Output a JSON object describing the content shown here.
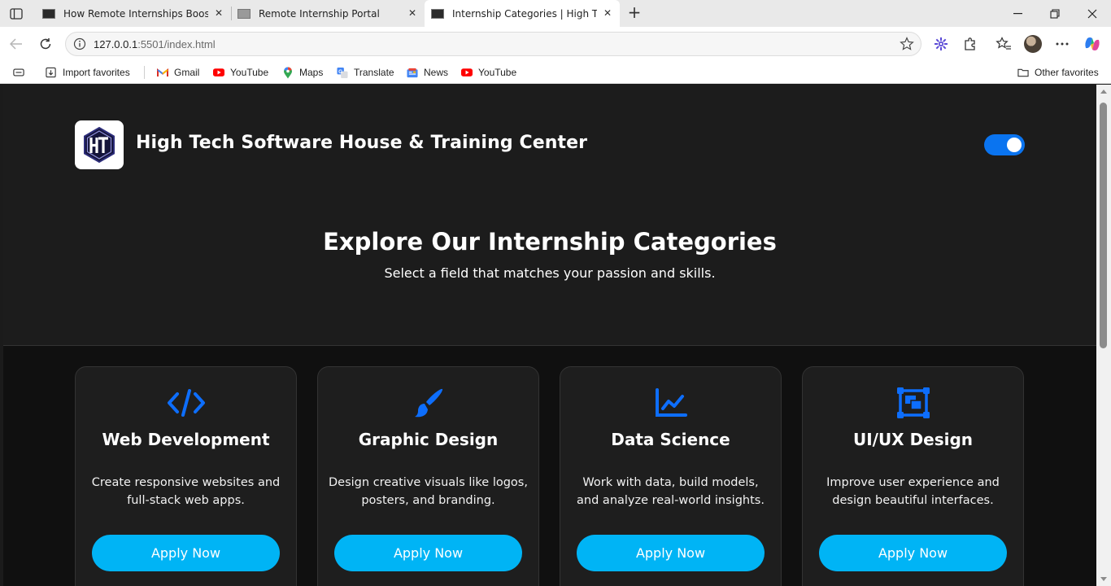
{
  "browser": {
    "tabs": [
      {
        "title": "How Remote Internships Boost Ca",
        "active": false
      },
      {
        "title": "Remote Internship Portal",
        "active": false
      },
      {
        "title": "Internship Categories | High Tech",
        "active": true
      }
    ],
    "url_host": "127.0.0.1",
    "url_rest": ":5501/index.html",
    "bookmarks": [
      {
        "label": "Import favorites",
        "icon": "import-icon"
      },
      {
        "label": "Gmail",
        "icon": "gmail-icon"
      },
      {
        "label": "YouTube",
        "icon": "youtube-icon"
      },
      {
        "label": "Maps",
        "icon": "maps-icon"
      },
      {
        "label": "Translate",
        "icon": "translate-icon"
      },
      {
        "label": "News",
        "icon": "news-icon"
      },
      {
        "label": "YouTube",
        "icon": "youtube-icon"
      }
    ],
    "other_favorites": "Other favorites"
  },
  "site": {
    "brand_name": "High Tech Software House & Training Center",
    "logo_text": "HT",
    "theme_toggle_on": true,
    "hero_title": "Explore Our Internship Categories",
    "hero_subtitle": "Select a field that matches your passion and skills.",
    "accent_color": "#0a74f0",
    "button_color": "#00b4f5",
    "categories": [
      {
        "title": "Web Development",
        "description": "Create responsive websites and full-stack web apps.",
        "button": "Apply Now",
        "icon": "code-icon"
      },
      {
        "title": "Graphic Design",
        "description": "Design creative visuals like logos, posters, and branding.",
        "button": "Apply Now",
        "icon": "paint-brush-icon"
      },
      {
        "title": "Data Science",
        "description": "Work with data, build models, and analyze real-world insights.",
        "button": "Apply Now",
        "icon": "chart-line-icon"
      },
      {
        "title": "UI/UX Design",
        "description": "Improve user experience and design beautiful interfaces.",
        "button": "Apply Now",
        "icon": "object-group-icon"
      }
    ]
  }
}
